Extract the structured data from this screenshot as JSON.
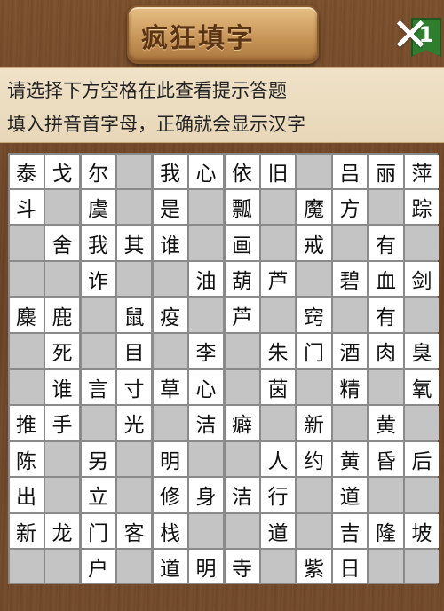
{
  "header": {
    "title": "疯狂填字",
    "level": "1",
    "close_icon": "close-icon"
  },
  "hints": {
    "line1": "请选择下方空格在此查看提示答题",
    "line2": "填入拼音首字母，正确就会显示汉字"
  },
  "colors": {
    "answer_cell": "#ffffff",
    "blank_cell": "#c4c4c4",
    "level_badge": "#2f7d2f"
  },
  "board": {
    "columns": 12,
    "rows": [
      [
        "泰",
        "戈",
        "尔",
        "#",
        "我",
        "心",
        "依",
        "旧",
        "#",
        "吕",
        "丽",
        "萍"
      ],
      [
        "斗",
        "#",
        "虞",
        "#",
        "是",
        "#",
        "瓢",
        "#",
        "魔",
        "方",
        "#",
        "踪"
      ],
      [
        "#",
        "舍",
        "我",
        "其",
        "谁",
        "#",
        "画",
        "#",
        "戒",
        "#",
        "有",
        "#"
      ],
      [
        "#",
        "#",
        "诈",
        "#",
        "#",
        "油",
        "葫",
        "芦",
        "#",
        "碧",
        "血",
        "剑"
      ],
      [
        "麋",
        "鹿",
        "#",
        "鼠",
        "疫",
        "#",
        "芦",
        "#",
        "窍",
        "#",
        "有",
        "#"
      ],
      [
        "#",
        "死",
        "#",
        "目",
        "#",
        "李",
        "#",
        "朱",
        "门",
        "酒",
        "肉",
        "臭"
      ],
      [
        "#",
        "谁",
        "言",
        "寸",
        "草",
        "心",
        "#",
        "茵",
        "#",
        "精",
        "#",
        "氧"
      ],
      [
        "推",
        "手",
        "#",
        "光",
        "#",
        "洁",
        "癖",
        "#",
        "新",
        "#",
        "黄",
        "#"
      ],
      [
        "陈",
        "#",
        "另",
        "#",
        "明",
        "#",
        "#",
        "人",
        "约",
        "黄",
        "昏",
        "后"
      ],
      [
        "出",
        "#",
        "立",
        "#",
        "修",
        "身",
        "洁",
        "行",
        "#",
        "道",
        "#",
        "#"
      ],
      [
        "新",
        "龙",
        "门",
        "客",
        "栈",
        "#",
        "#",
        "道",
        "#",
        "吉",
        "隆",
        "坡"
      ],
      [
        "#",
        "#",
        "户",
        "#",
        "道",
        "明",
        "寺",
        "#",
        "紫",
        "日",
        "#",
        "#"
      ]
    ]
  }
}
